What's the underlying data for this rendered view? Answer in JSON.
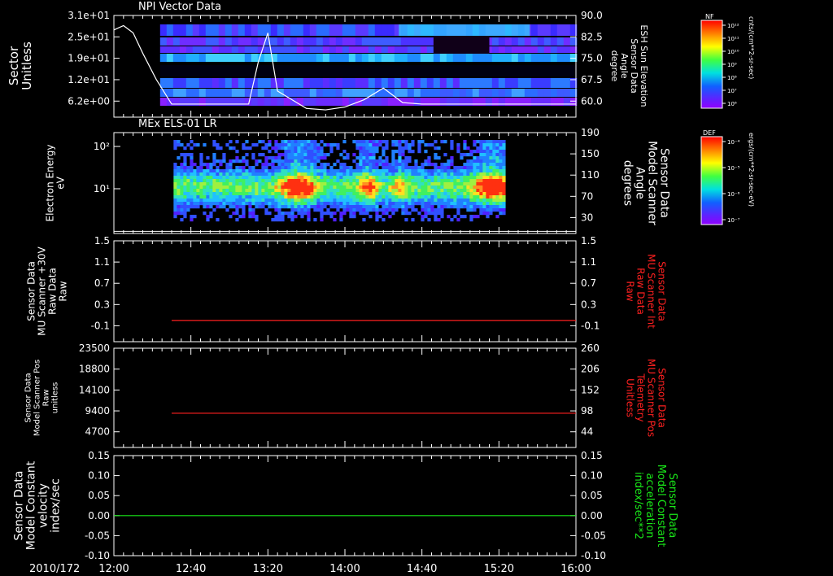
{
  "chart_data": [
    {
      "type": "heatmap",
      "title": "NPI Vector Data",
      "ylabel_left": [
        "Sector",
        "Unitless"
      ],
      "yticks_left": [
        "3.1e+01",
        "2.5e+01",
        "1.9e+01",
        "1.2e+01",
        "6.2e+00"
      ],
      "ylabel_right": [
        "ESH Sun Elevation",
        "Sensor Data",
        "Angle",
        "degree"
      ],
      "yticks_right": [
        "90.0",
        "82.5",
        "75.0",
        "67.5",
        "60.0"
      ],
      "ylim_right": [
        55,
        90
      ],
      "overlay_series": {
        "name": "ESH Sun Elevation Angle",
        "color": "#ffffff",
        "x_minutes": [
          0,
          5,
          10,
          15,
          22,
          30,
          40,
          50,
          60,
          70,
          75,
          80,
          85,
          90,
          100,
          110,
          120,
          130,
          140,
          142,
          150,
          160,
          180,
          200,
          240
        ],
        "y": [
          85,
          86.5,
          84,
          77,
          68,
          59.5,
          59.5,
          59.5,
          59.5,
          59.5,
          74,
          84,
          64,
          62,
          58,
          57.5,
          58.5,
          61,
          65,
          64,
          60,
          59.5,
          59.5,
          59.5,
          59.5
        ]
      },
      "colorbar": {
        "label": "NF",
        "units": "cnts/(cm**2-sr-sec)",
        "tick_labels": [
          "10¹²",
          "10¹¹",
          "10¹⁰",
          "10⁹",
          "10⁸",
          "10⁷",
          "10⁶"
        ]
      }
    },
    {
      "type": "heatmap",
      "title": "MEx ELS-01 LR",
      "ylabel_left": [
        "Electron Energy",
        "eV"
      ],
      "yticks_left": [
        "10²",
        "10¹"
      ],
      "yscale": "log",
      "ylabel_right": [
        "Sensor Data",
        "Model Scanner",
        "Angle",
        "degrees"
      ],
      "yticks_right": [
        "190",
        "150",
        "110",
        "70",
        "30"
      ],
      "ylim_right": [
        0,
        190
      ],
      "overlay_series": {
        "name": "Model Scanner Angle",
        "color": "#ffffff",
        "x_minutes": [
          0,
          240
        ],
        "y": [
          4,
          4
        ]
      },
      "colorbar": {
        "label": "DEF",
        "units": "ergs/(cm**2-sr-sec-eV)",
        "tick_labels": [
          "10⁻⁴",
          "10⁻⁵",
          "10⁻⁶",
          "10⁻⁷"
        ]
      }
    },
    {
      "type": "line",
      "ylabel_left": [
        "Sensor Data",
        "MU Scanner +30V",
        "Raw Data",
        "Raw"
      ],
      "yticks_left": [
        "1.5",
        "1.1",
        "0.7",
        "0.3",
        "-0.1"
      ],
      "ylim": [
        -0.4,
        1.5
      ],
      "ylabel_right": [
        "Sensor Data",
        "MU Scanner Int",
        "Raw Data",
        "Raw"
      ],
      "yticks_right": [
        "1.5",
        "1.1",
        "0.7",
        "0.3",
        "-0.1"
      ],
      "series": [
        {
          "name": "MU Scanner Int Raw Data",
          "color": "#ff2020",
          "x_minutes": [
            30,
            240
          ],
          "y": [
            0.0,
            0.0
          ]
        }
      ]
    },
    {
      "type": "line",
      "ylabel_left": [
        "Sensor Data",
        "Model Scanner Pos",
        "Raw",
        "unitless"
      ],
      "yticks_left": [
        "23500",
        "18800",
        "14100",
        "9400",
        "4700"
      ],
      "ylim": [
        0,
        23500
      ],
      "ylabel_right": [
        "Sensor Data",
        "MU Scanner Pos",
        "Telemetry",
        "Unitless"
      ],
      "yticks_right": [
        "260",
        "206",
        "152",
        "98",
        "44"
      ],
      "series": [
        {
          "name": "MU Scanner Pos Telemetry",
          "color": "#ff2020",
          "x_minutes": [
            30,
            240
          ],
          "y": [
            8100,
            8100
          ]
        }
      ]
    },
    {
      "type": "line",
      "ylabel_left": [
        "Sensor Data",
        "Model Constant",
        "velocity",
        "index/sec"
      ],
      "yticks_left": [
        "0.15",
        "0.10",
        "0.05",
        "0.00",
        "-0.05",
        "-0.10"
      ],
      "ylim": [
        -0.1,
        0.15
      ],
      "ylabel_right": [
        "Sensor Data",
        "Model Constant",
        "acceleration",
        "index/sec**2"
      ],
      "yticks_right": [
        "0.15",
        "0.10",
        "0.05",
        "0.00",
        "-0.05",
        "-0.10"
      ],
      "series": [
        {
          "name": "Model Constant acceleration",
          "color": "#19e619",
          "x_minutes": [
            0,
            240
          ],
          "y": [
            0.0,
            0.0
          ]
        }
      ]
    }
  ],
  "x_axis": {
    "date_label": "2010/172",
    "tick_labels": [
      "12:00",
      "12:40",
      "13:20",
      "14:00",
      "14:40",
      "15:20",
      "16:00"
    ],
    "tick_minutes": [
      0,
      40,
      80,
      120,
      160,
      200,
      240
    ]
  },
  "colors": {
    "background": "#000000",
    "axis": "#ffffff",
    "red_series": "#ff2020",
    "green_series": "#19e619"
  }
}
